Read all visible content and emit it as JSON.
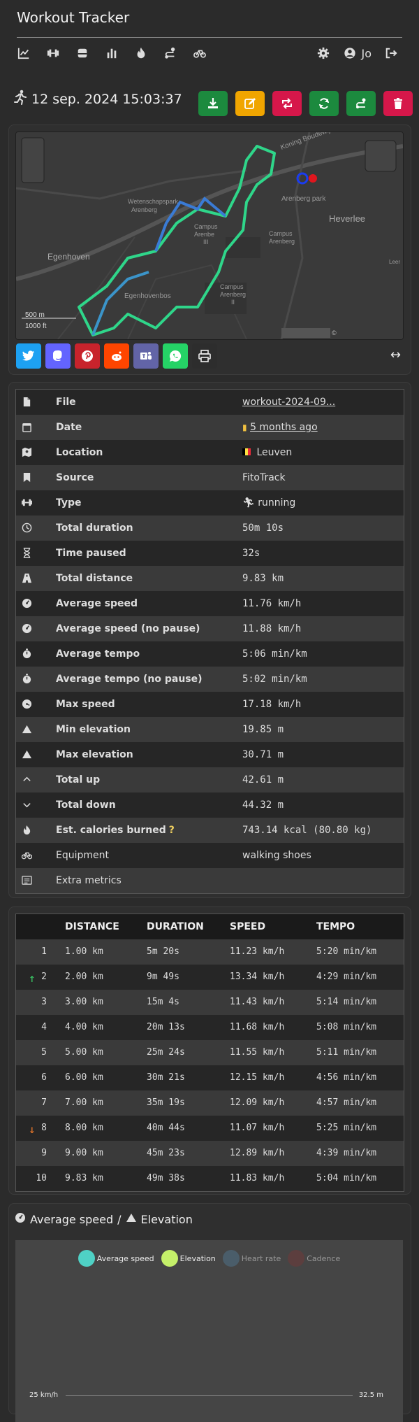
{
  "app": {
    "title": "Workout Tracker",
    "user": "Jo"
  },
  "workout": {
    "title": "12 sep. 2024 15:03:37"
  },
  "map": {
    "scale_metric": "500 m",
    "scale_imperial": "1000 ft",
    "attribution": "©",
    "labels": {
      "koning": "Koning Boudewijnlaan",
      "wetenschapspark": "Wetenschapspark",
      "arenberg": "Arenberg",
      "arenberg_park": "Arenberg park",
      "heverlee": "Heverlee",
      "egenhoven": "Egenhoven",
      "egenhovenbos": "Egenhovenbos",
      "campus1": "Campus",
      "campus1b": "Arenbe",
      "campus1c": "III",
      "campus2": "Campus",
      "campus2b": "Arenberg",
      "campus3": "Campus",
      "campus3b": "Arenberg",
      "campus3c": "II",
      "leuven": "Leer"
    }
  },
  "info": {
    "file_label": "File",
    "file_value": "workout-2024-09...",
    "date_label": "Date",
    "date_value": "5 months ago",
    "location_label": "Location",
    "location_value": "Leuven",
    "source_label": "Source",
    "source_value": "FitoTrack",
    "type_label": "Type",
    "type_value": "running",
    "total_duration_label": "Total duration",
    "total_duration_value": "50m 10s",
    "time_paused_label": "Time paused",
    "time_paused_value": "32s",
    "total_distance_label": "Total distance",
    "total_distance_value": "9.83 km",
    "avg_speed_label": "Average speed",
    "avg_speed_value": "11.76 km/h",
    "avg_speed_np_label": "Average speed (no pause)",
    "avg_speed_np_value": "11.88 km/h",
    "avg_tempo_label": "Average tempo",
    "avg_tempo_value": "5:06 min/km",
    "avg_tempo_np_label": "Average tempo (no pause)",
    "avg_tempo_np_value": "5:02 min/km",
    "max_speed_label": "Max speed",
    "max_speed_value": "17.18 km/h",
    "min_elev_label": "Min elevation",
    "min_elev_value": "19.85 m",
    "max_elev_label": "Max elevation",
    "max_elev_value": "30.71 m",
    "total_up_label": "Total up",
    "total_up_value": "42.61 m",
    "total_down_label": "Total down",
    "total_down_value": "44.32 m",
    "calories_label": "Est. calories burned",
    "calories_help": "?",
    "calories_value": "743.14 kcal (80.80 kg)",
    "equipment_label": "Equipment",
    "equipment_value": "walking shoes",
    "extra_label": "Extra metrics"
  },
  "splits": {
    "headers": {
      "distance": "DISTANCE",
      "duration": "DURATION",
      "speed": "SPEED",
      "tempo": "TEMPO"
    },
    "rows": [
      {
        "marker": "",
        "n": "1",
        "distance": "1.00 km",
        "duration": "5m 20s",
        "speed": "11.23 km/h",
        "tempo": "5:20 min/km"
      },
      {
        "marker": "↑",
        "n": "2",
        "distance": "2.00 km",
        "duration": "9m 49s",
        "speed": "13.34 km/h",
        "tempo": "4:29 min/km"
      },
      {
        "marker": "",
        "n": "3",
        "distance": "3.00 km",
        "duration": "15m 4s",
        "speed": "11.43 km/h",
        "tempo": "5:14 min/km"
      },
      {
        "marker": "",
        "n": "4",
        "distance": "4.00 km",
        "duration": "20m 13s",
        "speed": "11.68 km/h",
        "tempo": "5:08 min/km"
      },
      {
        "marker": "",
        "n": "5",
        "distance": "5.00 km",
        "duration": "25m 24s",
        "speed": "11.55 km/h",
        "tempo": "5:11 min/km"
      },
      {
        "marker": "",
        "n": "6",
        "distance": "6.00 km",
        "duration": "30m 21s",
        "speed": "12.15 km/h",
        "tempo": "4:56 min/km"
      },
      {
        "marker": "",
        "n": "7",
        "distance": "7.00 km",
        "duration": "35m 19s",
        "speed": "12.09 km/h",
        "tempo": "4:57 min/km"
      },
      {
        "marker": "↓",
        "n": "8",
        "distance": "8.00 km",
        "duration": "40m 44s",
        "speed": "11.07 km/h",
        "tempo": "5:25 min/km"
      },
      {
        "marker": "",
        "n": "9",
        "distance": "9.00 km",
        "duration": "45m 23s",
        "speed": "12.89 km/h",
        "tempo": "4:39 min/km"
      },
      {
        "marker": "",
        "n": "10",
        "distance": "9.83 km",
        "duration": "49m 38s",
        "speed": "11.83 km/h",
        "tempo": "5:04 min/km"
      }
    ]
  },
  "chart": {
    "title_a": "Average speed",
    "title_sep": "/",
    "title_b": "Elevation",
    "legend": [
      {
        "name": "Average speed",
        "color": "#4fd1c5",
        "active": true
      },
      {
        "name": "Elevation",
        "color": "#c5f06a",
        "active": true
      },
      {
        "name": "Heart rate",
        "color": "#4a5d6a",
        "active": false
      },
      {
        "name": "Cadence",
        "color": "#5c3e3e",
        "active": false
      }
    ],
    "axis_left": "25 km/h",
    "axis_right": "32.5 m"
  },
  "colors": {
    "download": "#1c8a3e",
    "edit": "#f0a500",
    "repeat": "#d6174a",
    "refresh": "#1c8a3e",
    "route": "#1c8a3e",
    "delete": "#d6174a",
    "twitter": "#1da1f2",
    "mastodon": "#6364ff",
    "pinterest": "#c8232c",
    "reddit": "#ff4500",
    "teams": "#6264a7",
    "whatsapp": "#25d366",
    "print": "#2d2d2d"
  }
}
